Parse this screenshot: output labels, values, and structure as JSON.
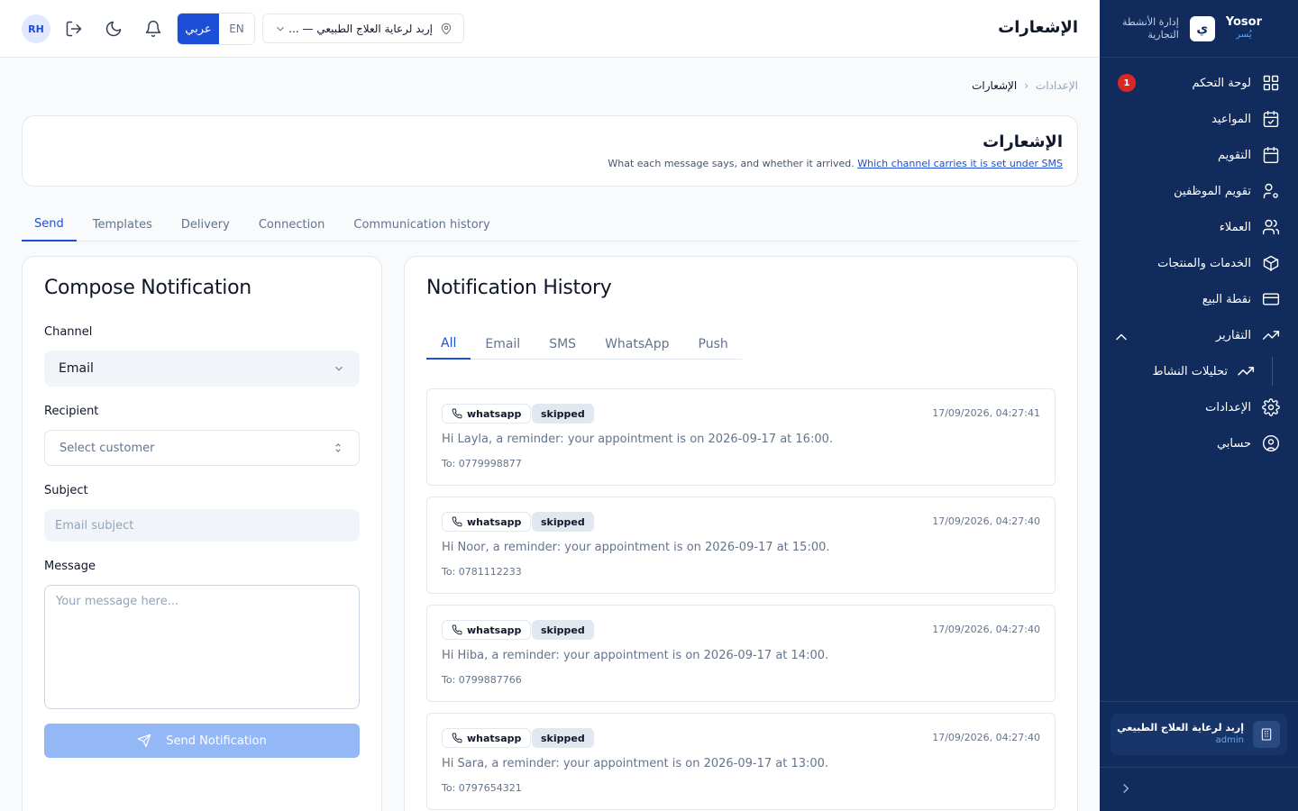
{
  "brand": {
    "name": "Yosor",
    "name_ar": "يُسر",
    "logo_letter": "ي",
    "subtitle_line1": "إدارة الأنشطة",
    "subtitle_line2": "التجارية"
  },
  "sidebar": {
    "items": [
      {
        "label": "لوحة التحكم",
        "icon": "grid-icon",
        "badge": "1"
      },
      {
        "label": "المواعيد",
        "icon": "calendar-check-icon"
      },
      {
        "label": "التقويم",
        "icon": "calendar-icon"
      },
      {
        "label": "تقويم الموظفين",
        "icon": "user-gear-icon"
      },
      {
        "label": "العملاء",
        "icon": "users-icon"
      },
      {
        "label": "الخدمات والمنتجات",
        "icon": "box-icon"
      },
      {
        "label": "نقطة البيع",
        "icon": "credit-card-icon"
      },
      {
        "label": "التقارير",
        "icon": "trending-up-icon"
      },
      {
        "label": "تحليلات النشاط",
        "icon": "trending-up-icon"
      },
      {
        "label": "الإعدادات",
        "icon": "gear-icon"
      },
      {
        "label": "حسابي",
        "icon": "user-circle-icon"
      }
    ],
    "org": {
      "name": "إربد لرعاية العلاج الطبيعي",
      "role": "admin"
    }
  },
  "topbar": {
    "title": "الإشعارات",
    "avatar": "RH",
    "lang_ar": "عربي",
    "lang_en": "EN",
    "branch": "إربد لرعاية العلاج الطبيعي — ..."
  },
  "breadcrumb": {
    "parent": "الإعدادات",
    "current": "الإشعارات"
  },
  "header": {
    "title": "الإشعارات",
    "desc_text": "What each message says, and whether it arrived.",
    "desc_link": "Which channel carries it is set under SMS"
  },
  "tabs": [
    "Send",
    "Templates",
    "Delivery",
    "Connection",
    "Communication history"
  ],
  "compose": {
    "title": "Compose Notification",
    "channel_label": "Channel",
    "channel_value": "Email",
    "recipient_label": "Recipient",
    "recipient_placeholder": "Select customer",
    "subject_label": "Subject",
    "subject_placeholder": "Email subject",
    "message_label": "Message",
    "message_placeholder": "Your message here...",
    "send_label": "Send Notification"
  },
  "history": {
    "title": "Notification History",
    "filters": [
      "All",
      "Email",
      "SMS",
      "WhatsApp",
      "Push"
    ],
    "messages": [
      {
        "channel": "whatsapp",
        "status": "skipped",
        "time": "17/09/2026, 04:27:41",
        "body": "Hi Layla, a reminder: your appointment is on 2026-09-17 at 16:00.",
        "to": "To: 0779998877"
      },
      {
        "channel": "whatsapp",
        "status": "skipped",
        "time": "17/09/2026, 04:27:40",
        "body": "Hi Noor, a reminder: your appointment is on 2026-09-17 at 15:00.",
        "to": "To: 0781112233"
      },
      {
        "channel": "whatsapp",
        "status": "skipped",
        "time": "17/09/2026, 04:27:40",
        "body": "Hi Hiba, a reminder: your appointment is on 2026-09-17 at 14:00.",
        "to": "To: 0799887766"
      },
      {
        "channel": "whatsapp",
        "status": "skipped",
        "time": "17/09/2026, 04:27:40",
        "body": "Hi Sara, a reminder: your appointment is on 2026-09-17 at 13:00.",
        "to": "To: 0797654321"
      }
    ]
  }
}
